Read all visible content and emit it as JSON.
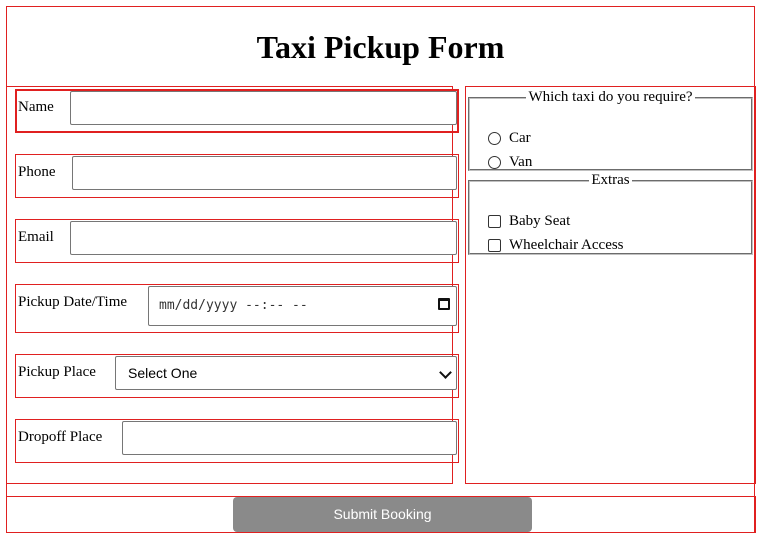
{
  "form": {
    "title": "Taxi Pickup Form",
    "fields": {
      "name": {
        "label": "Name",
        "value": ""
      },
      "phone": {
        "label": "Phone",
        "value": ""
      },
      "email": {
        "label": "Email",
        "value": ""
      },
      "pickup_datetime": {
        "label": "Pickup Date/Time",
        "placeholder": "mm/dd/yyyy --:-- --"
      },
      "pickup_place": {
        "label": "Pickup Place",
        "selected": "Select One"
      },
      "dropoff_place": {
        "label": "Dropoff Place",
        "value": ""
      }
    },
    "taxi_type": {
      "legend": "Which taxi do you require?",
      "options": [
        "Car",
        "Van"
      ]
    },
    "extras": {
      "legend": "Extras",
      "options": [
        "Baby Seat",
        "Wheelchair Access"
      ]
    },
    "submit_label": "Submit Booking"
  },
  "colors": {
    "outline": "#e02020",
    "button_bg": "#8a8a8a",
    "button_text": "#ffffff"
  },
  "icons": {
    "calendar": "calendar-icon",
    "dropdown": "chevron-down-icon"
  }
}
